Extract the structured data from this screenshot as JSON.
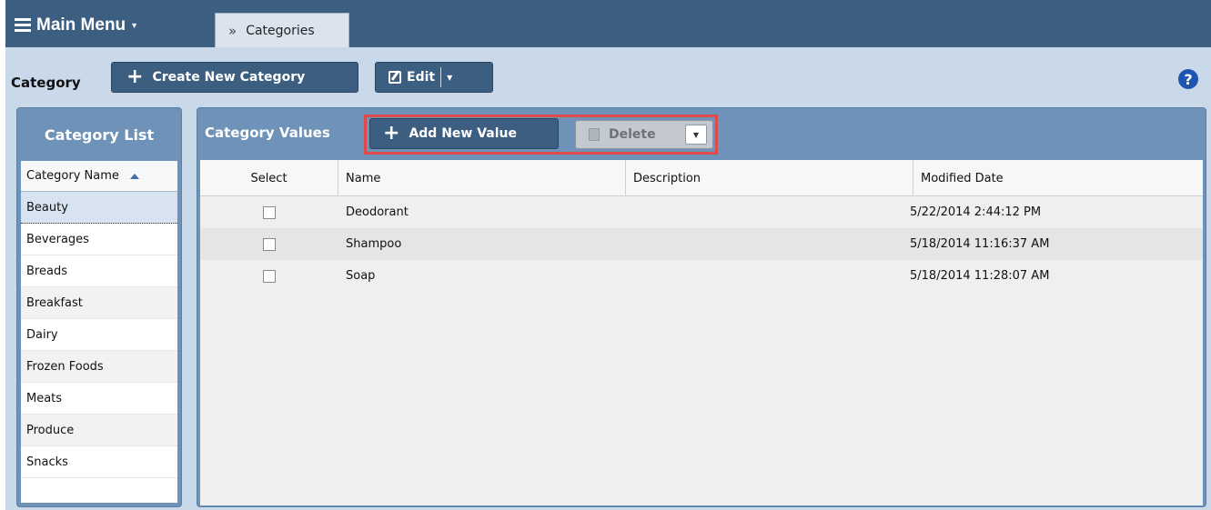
{
  "header": {
    "main_menu_label": "Main Menu",
    "tabs": [
      {
        "label": "Categories"
      }
    ]
  },
  "toolbar": {
    "label": "Category",
    "create_button": "Create New Category",
    "edit_button": "Edit",
    "help_icon": "?"
  },
  "category_list": {
    "title": "Category List",
    "column_header": "Category Name",
    "items": [
      "Beauty",
      "Beverages",
      "Breads",
      "Breakfast",
      "Dairy",
      "Frozen Foods",
      "Meats",
      "Produce",
      "Snacks"
    ],
    "selected": "Beauty"
  },
  "category_values": {
    "title": "Category Values",
    "add_button": "Add New Value",
    "delete_button": "Delete",
    "columns": [
      "Select",
      "Name",
      "Description",
      "Modified Date"
    ],
    "rows": [
      {
        "name": "Deodorant",
        "description": "",
        "modified": "5/22/2014 2:44:12 PM"
      },
      {
        "name": "Shampoo",
        "description": "",
        "modified": "5/18/2014 11:16:37 AM"
      },
      {
        "name": "Soap",
        "description": "",
        "modified": "5/18/2014 11:28:07 AM"
      }
    ]
  },
  "colors": {
    "header_bar": "#3c5e80",
    "toolbar_bg": "#c9d9ea",
    "panel_bg": "#6f92b8",
    "highlight_border": "#e04a4a",
    "help_icon": "#1e55b0"
  }
}
